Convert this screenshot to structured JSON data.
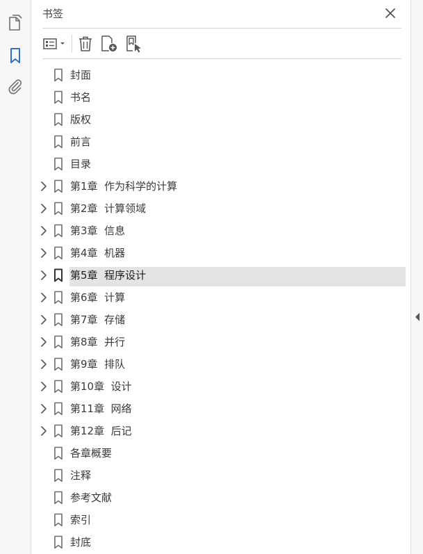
{
  "side_rail": {
    "items": [
      {
        "name": "pages-icon",
        "active": false
      },
      {
        "name": "bookmarks-icon",
        "active": true
      },
      {
        "name": "attachments-icon",
        "active": false
      }
    ]
  },
  "panel": {
    "title": "书签"
  },
  "toolbar": {
    "items": [
      "options-menu-icon",
      "delete-bookmark-icon",
      "new-bookmark-icon",
      "find-current-bookmark-icon"
    ]
  },
  "bookmarks": [
    {
      "label": "封面",
      "expandable": false,
      "selected": false
    },
    {
      "label": "书名",
      "expandable": false,
      "selected": false
    },
    {
      "label": "版权",
      "expandable": false,
      "selected": false
    },
    {
      "label": "前言",
      "expandable": false,
      "selected": false
    },
    {
      "label": "目录",
      "expandable": false,
      "selected": false
    },
    {
      "label": "第1章  作为科学的计算",
      "expandable": true,
      "selected": false
    },
    {
      "label": "第2章  计算领域",
      "expandable": true,
      "selected": false
    },
    {
      "label": "第3章  信息",
      "expandable": true,
      "selected": false
    },
    {
      "label": "第4章  机器",
      "expandable": true,
      "selected": false
    },
    {
      "label": "第5章  程序设计",
      "expandable": true,
      "selected": true
    },
    {
      "label": "第6章  计算",
      "expandable": true,
      "selected": false
    },
    {
      "label": "第7章  存储",
      "expandable": true,
      "selected": false
    },
    {
      "label": "第8章  并行",
      "expandable": true,
      "selected": false
    },
    {
      "label": "第9章  排队",
      "expandable": true,
      "selected": false
    },
    {
      "label": "第10章  设计",
      "expandable": true,
      "selected": false
    },
    {
      "label": "第11章  网络",
      "expandable": true,
      "selected": false
    },
    {
      "label": "第12章  后记",
      "expandable": true,
      "selected": false
    },
    {
      "label": "各章概要",
      "expandable": false,
      "selected": false
    },
    {
      "label": "注释",
      "expandable": false,
      "selected": false
    },
    {
      "label": "参考文献",
      "expandable": false,
      "selected": false
    },
    {
      "label": "索引",
      "expandable": false,
      "selected": false
    },
    {
      "label": "封底",
      "expandable": false,
      "selected": false
    }
  ],
  "colors": {
    "active_icon": "#2b73c7",
    "icon": "#6e6e6e",
    "selected_row": "#e4e4e4"
  }
}
